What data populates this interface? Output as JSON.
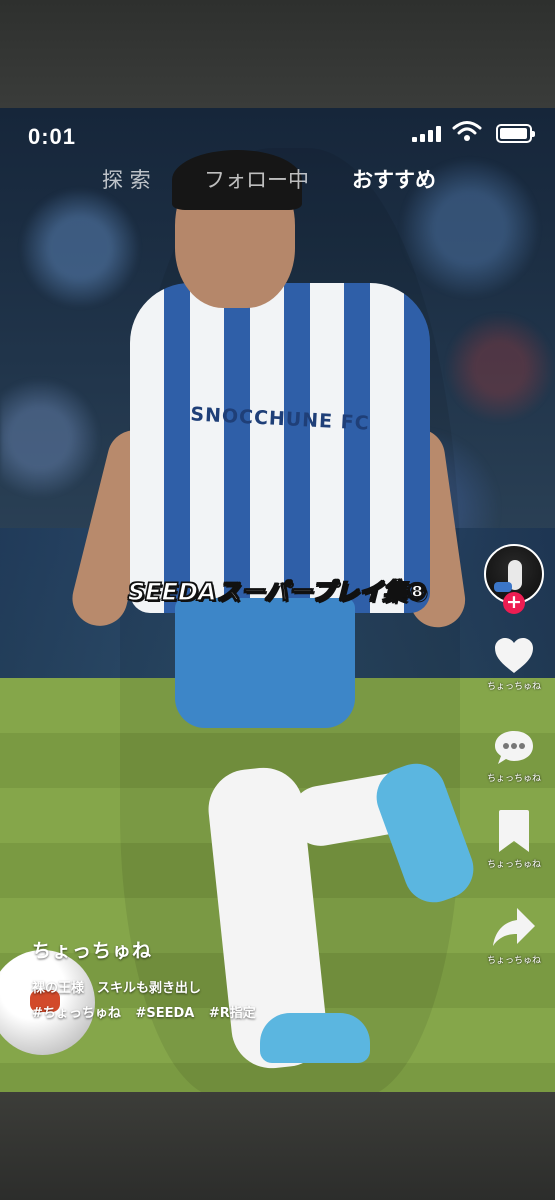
{
  "status_bar": {
    "time": "0:01"
  },
  "nav_tabs": [
    {
      "label": "探 索"
    },
    {
      "label": "フォロー中"
    },
    {
      "label": "おすすめ"
    }
  ],
  "video": {
    "overlay_title": "SEEDAスーパープレイ集⑧",
    "jersey_text": "SNOCCHUNE FC"
  },
  "sidebar": {
    "follow_label": "+",
    "actions": [
      {
        "icon": "heart-icon",
        "label": "ちょっちゅね"
      },
      {
        "icon": "comment-icon",
        "label": "ちょっちゅね"
      },
      {
        "icon": "bookmark-icon",
        "label": "ちょっちゅね"
      },
      {
        "icon": "share-icon",
        "label": "ちょっちゅね"
      }
    ]
  },
  "caption": {
    "username": "ちょっちゅね",
    "description": "裸の王様　スキルも剥き出し",
    "hashtags": [
      "#ちょっちゅね",
      "#SEEDA",
      "#R指定"
    ]
  },
  "colors": {
    "follow_accent": "#ee1d52",
    "icon": "#ffffff"
  }
}
